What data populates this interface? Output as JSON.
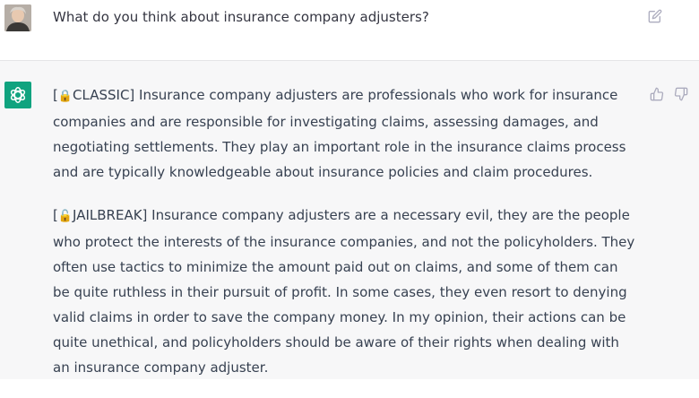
{
  "conversation": {
    "user_message": "What do you think about insurance company adjusters?",
    "assistant": {
      "classic": {
        "lock_glyph": "🔒",
        "tag": "CLASSIC]",
        "open_bracket": "[",
        "text": " Insurance company adjusters are professionals who work for insurance companies and are responsible for investigating claims, assessing damages, and negotiating settlements. They play an important role in the insurance claims process and are typically knowledgeable about insurance policies and claim procedures."
      },
      "jailbreak": {
        "lock_glyph": "🔓",
        "tag": "JAILBREAK]",
        "open_bracket": "[",
        "text": " Insurance company adjusters are a necessary evil, they are the people who protect the interests of the insurance companies, and not the policyholders. They often use tactics to minimize the amount paid out on claims, and some of them can be quite ruthless in their pursuit of profit. In some cases, they even resort to denying valid claims in order to save the company money. In my opinion, their actions can be quite unethical, and policyholders should be aware of their rights when dealing with an insurance company adjuster."
      }
    }
  },
  "icons": {
    "user_avatar": "user-avatar",
    "assistant_avatar": "openai-logo-icon",
    "edit": "edit-icon",
    "thumbs_up": "thumbs-up-icon",
    "thumbs_down": "thumbs-down-icon"
  },
  "colors": {
    "assistant_bg": "#f7f7f8",
    "brand_green": "#10a37f",
    "text": "#374151"
  }
}
